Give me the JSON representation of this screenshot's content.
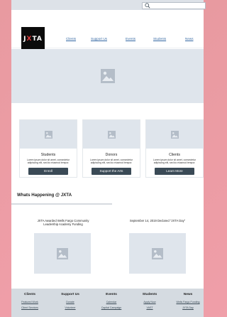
{
  "header": {
    "logo": {
      "part1": "J",
      "part2": "X",
      "part3": "TA"
    },
    "nav": [
      "Clients",
      "Support Us",
      "Events",
      "Students",
      "News"
    ]
  },
  "cards": [
    {
      "title": "Students",
      "text": "Lorem ipsum dolor sit amet, consectetur adipiscing elit, sed do eiusmod tempor.",
      "button": "Enroll"
    },
    {
      "title": "Donors",
      "text": "Lorem ipsum dolor sit amet, consectetur adipiscing elit, sed do eiusmod tempor.",
      "button": "Support the Arts"
    },
    {
      "title": "Clients",
      "text": "Lorem ipsum dolor sit amet, consectetur adipiscing elit, sed do eiusmod tempor.",
      "button": "Learn More"
    }
  ],
  "happening": {
    "title": "Whats Happening @ JXTA",
    "news": [
      {
        "title": "JXTA Awarded Wells Fargo Community Leadership Academy Funding"
      },
      {
        "title": "September 14, 2019 Declared \"JXTA Day\""
      }
    ]
  },
  "footer": {
    "columns": [
      {
        "heading": "Clients",
        "links": [
          "Featured Work",
          "Client Services"
        ]
      },
      {
        "heading": "Support Us",
        "links": [
          "Donate",
          "Volunteer"
        ]
      },
      {
        "heading": "Events",
        "links": [
          "Calendar",
          "Capital Campaign"
        ]
      },
      {
        "heading": "Students",
        "links": [
          "Apply Now",
          "VAST"
        ]
      },
      {
        "heading": "News",
        "links": [
          "Wells Fargo Funding",
          "JXTA Day"
        ]
      }
    ]
  },
  "colors": {
    "accent": "#e23b3b",
    "button": "#3a4a56",
    "placeholder": "#dfe5ec",
    "link": "#3468a3"
  }
}
